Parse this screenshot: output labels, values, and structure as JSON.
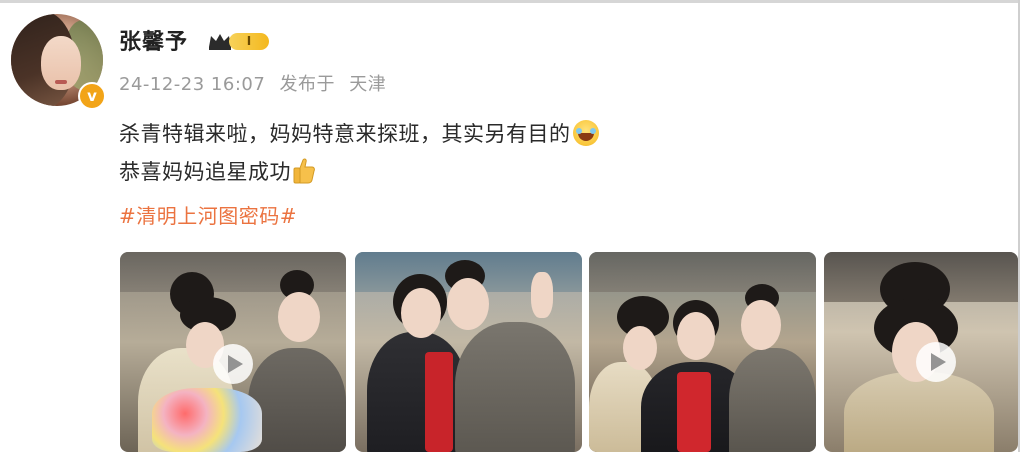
{
  "post": {
    "username": "张馨予",
    "member_level": "I",
    "timestamp": "24-12-23 16:07",
    "source_prefix": "发布于",
    "location": "天津",
    "line1": "杀青特辑来啦，妈妈特意来探班，其实另有目的",
    "line2": "恭喜妈妈追星成功",
    "hashtag": "#清明上河图密码#",
    "emoji_line1": "laugh-tears-icon",
    "emoji_line2": "thumbs-up-icon"
  },
  "media": {
    "thumbnails": [
      {
        "name": "video-thumbnail-1",
        "has_play": true
      },
      {
        "name": "video-thumbnail-2",
        "has_play": false
      },
      {
        "name": "video-thumbnail-3",
        "has_play": false
      },
      {
        "name": "video-thumbnail-4",
        "has_play": true
      }
    ]
  },
  "colors": {
    "hashtag": "#eb7340",
    "verified_badge": "#f2a418",
    "meta_text": "#9a9a9a"
  }
}
